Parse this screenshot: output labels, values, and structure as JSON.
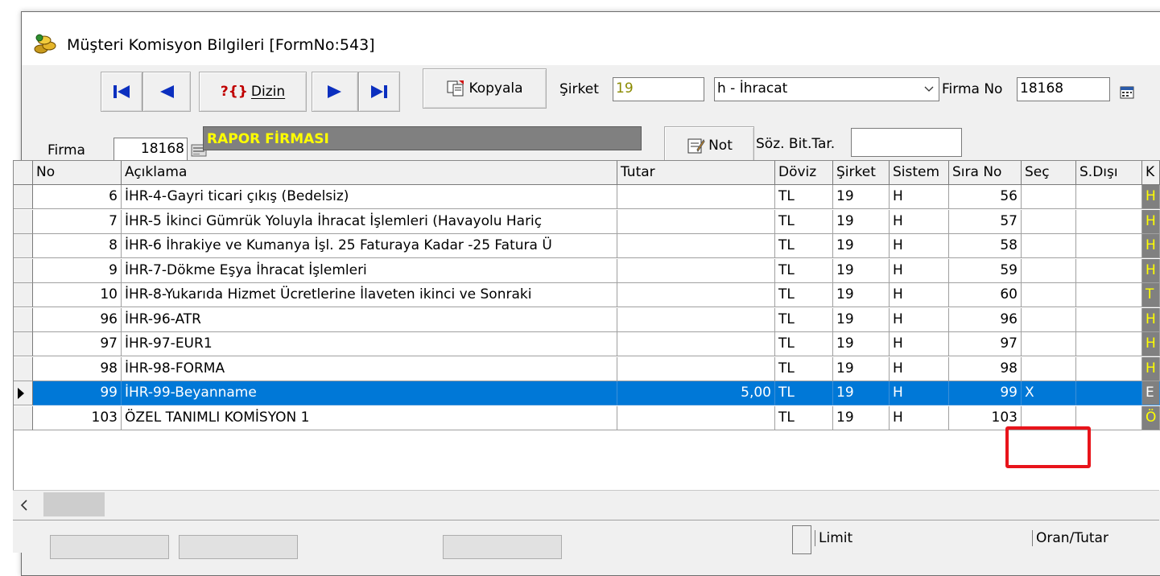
{
  "window": {
    "title": "Müşteri Komisyon Bilgileri [FormNo:543]"
  },
  "toolbar": {
    "dizin_label": "Dizin",
    "kopyala_label": "Kopyala",
    "sirket_label": "Şirket",
    "sirket_value": "19",
    "company_type": "h - İhracat",
    "firma_no_label": "Firma No",
    "firma_no_value": "18168"
  },
  "firma": {
    "label": "Firma",
    "code": "18168",
    "name": "RAPOR FİRMASI",
    "not_label": "Not",
    "soz_bit_label": "Söz. Bit.Tar.",
    "soz_bit_value": ""
  },
  "grid": {
    "headers": [
      "No",
      "Açıklama",
      "Tutar",
      "Döviz",
      "Şirket",
      "Sistem",
      "Sıra No",
      "Seç",
      "S.Dışı",
      "K"
    ],
    "rows": [
      {
        "no": "6",
        "aciklama": "İHR-4-Gayri ticari çıkış (Bedelsiz)",
        "tutar": "",
        "doviz": "TL",
        "sirket": "19",
        "sistem": "H",
        "sira": "56",
        "sec": "",
        "sdisi": "",
        "k": "H"
      },
      {
        "no": "7",
        "aciklama": "İHR-5 İkinci Gümrük Yoluyla İhracat İşlemleri (Havayolu Hariç",
        "tutar": "",
        "doviz": "TL",
        "sirket": "19",
        "sistem": "H",
        "sira": "57",
        "sec": "",
        "sdisi": "",
        "k": "H"
      },
      {
        "no": "8",
        "aciklama": "İHR-6 İhrakiye ve Kumanya İşl. 25 Faturaya Kadar -25 Fatura Ü",
        "tutar": "",
        "doviz": "TL",
        "sirket": "19",
        "sistem": "H",
        "sira": "58",
        "sec": "",
        "sdisi": "",
        "k": "H"
      },
      {
        "no": "9",
        "aciklama": "İHR-7-Dökme Eşya İhracat İşlemleri",
        "tutar": "",
        "doviz": "TL",
        "sirket": "19",
        "sistem": "H",
        "sira": "59",
        "sec": "",
        "sdisi": "",
        "k": "H"
      },
      {
        "no": "10",
        "aciklama": "İHR-8-Yukarıda Hizmet Ücretlerine İlaveten ikinci ve Sonraki",
        "tutar": "",
        "doviz": "TL",
        "sirket": "19",
        "sistem": "H",
        "sira": "60",
        "sec": "",
        "sdisi": "",
        "k": "T"
      },
      {
        "no": "96",
        "aciklama": "İHR-96-ATR",
        "tutar": "",
        "doviz": "TL",
        "sirket": "19",
        "sistem": "H",
        "sira": "96",
        "sec": "",
        "sdisi": "",
        "k": "H"
      },
      {
        "no": "97",
        "aciklama": "İHR-97-EUR1",
        "tutar": "",
        "doviz": "TL",
        "sirket": "19",
        "sistem": "H",
        "sira": "97",
        "sec": "",
        "sdisi": "",
        "k": "H"
      },
      {
        "no": "98",
        "aciklama": "İHR-98-FORMA",
        "tutar": "",
        "doviz": "TL",
        "sirket": "19",
        "sistem": "H",
        "sira": "98",
        "sec": "",
        "sdisi": "",
        "k": "H"
      },
      {
        "no": "99",
        "aciklama": "İHR-99-Beyanname",
        "tutar": "5,00",
        "doviz": "TL",
        "sirket": "19",
        "sistem": "H",
        "sira": "99",
        "sec": "X",
        "sdisi": "",
        "k": "E"
      },
      {
        "no": "103",
        "aciklama": "ÖZEL TANIMLI KOMİSYON 1",
        "tutar": "",
        "doviz": "TL",
        "sirket": "19",
        "sistem": "H",
        "sira": "103",
        "sec": "",
        "sdisi": "",
        "k": "Ö"
      }
    ]
  },
  "bottom": {
    "limit_label": "Limit",
    "oran_label": "Oran/Tutar"
  }
}
